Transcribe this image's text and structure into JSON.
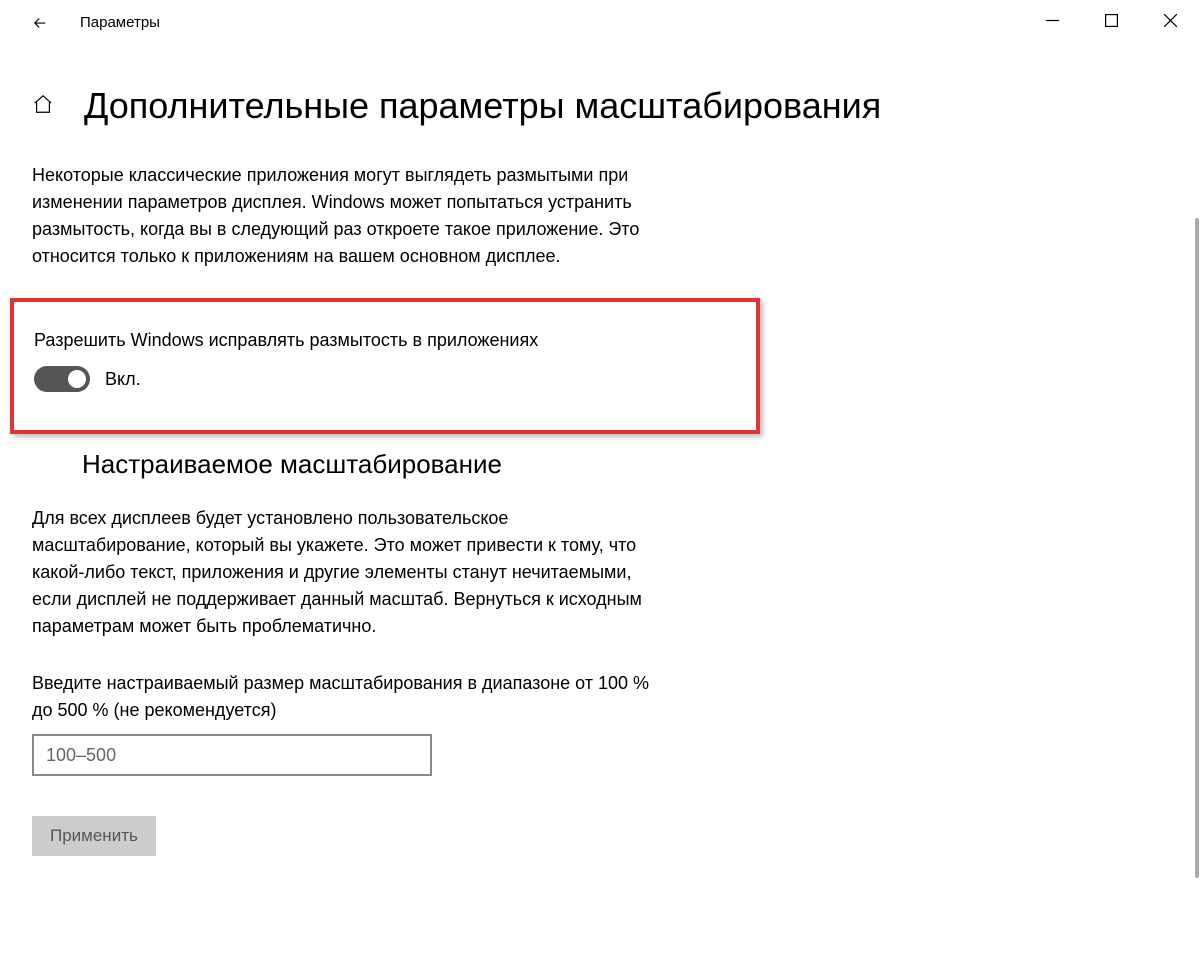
{
  "titlebar": {
    "title": "Параметры"
  },
  "header": {
    "page_title": "Дополнительные параметры масштабирования"
  },
  "main": {
    "blur_description": "Некоторые классические приложения могут выглядеть размытыми при изменении параметров дисплея. Windows может попытаться устранить размытость, когда вы в следующий раз откроете такое приложение. Это относится только к приложениям на вашем основном дисплее.",
    "fix_blur_label": "Разрешить Windows исправлять размытость в приложениях",
    "toggle_state": "Вкл.",
    "custom_scaling_heading": "Настраиваемое масштабирование",
    "custom_scaling_desc": "Для всех дисплеев будет установлено пользовательское масштабирование, который вы укажете. Это может привести к тому, что какой-либо текст, приложения и другие элементы станут нечитаемыми, если дисплей не поддерживает данный масштаб. Вернуться к исходным параметрам может быть проблематично.",
    "scale_input_label": "Введите настраиваемый размер масштабирования в диапазоне от 100 % до 500 % (не рекомендуется)",
    "scale_placeholder": "100–500",
    "apply_label": "Применить"
  }
}
